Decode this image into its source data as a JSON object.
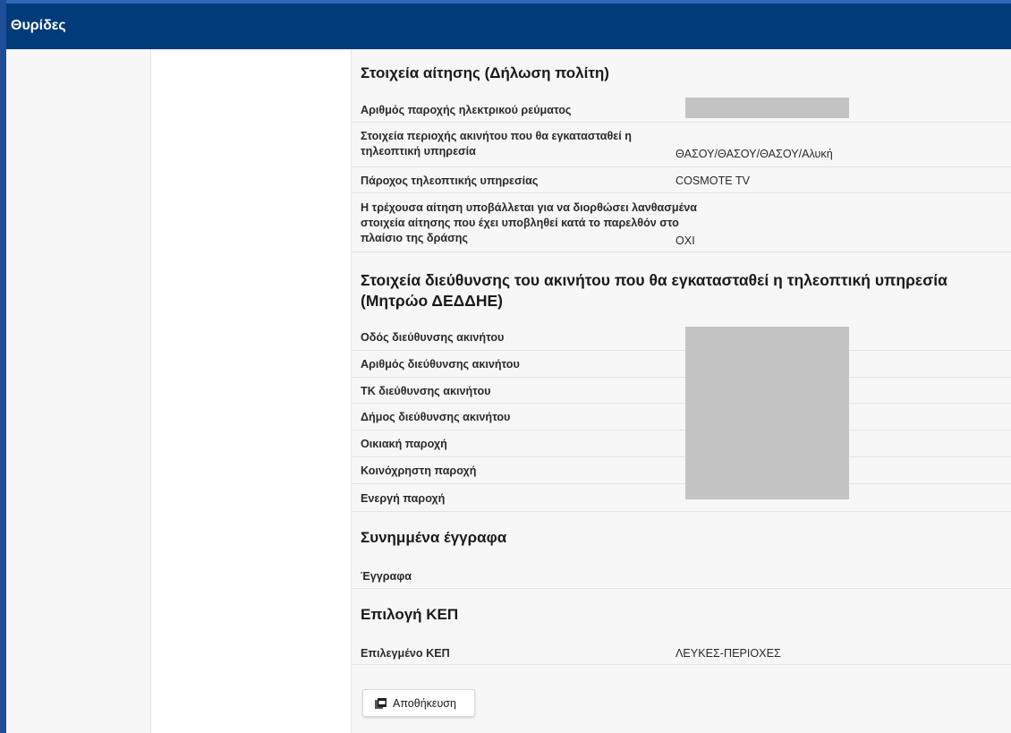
{
  "header": {
    "title": "Θυρίδες"
  },
  "sections": {
    "application": {
      "title": "Στοιχεία αίτησης (Δήλωση πολίτη)",
      "rows": [
        {
          "label": "Αριθμός παροχής ηλεκτρικού ρεύματος",
          "value": ""
        },
        {
          "label": "Στοιχεία περιοχής ακινήτου που θα εγκατασταθεί η τηλεοπτική υπηρεσία",
          "value": "ΘΑΣΟΥ/ΘΑΣΟΥ/ΘΑΣΟΥ/Αλυκή"
        },
        {
          "label": "Πάροχος τηλεοπτικής υπηρεσίας",
          "value": "COSMOTE TV"
        },
        {
          "label": "Η τρέχουσα αίτηση υποβάλλεται για να διορθώσει λανθασμένα στοιχεία αίτησης που έχει υποβληθεί κατά το παρελθόν στο πλαίσιο της δράσης",
          "value": "ΟΧΙ"
        }
      ]
    },
    "address": {
      "title": "Στοιχεία διεύθυνσης του ακινήτου που θα εγκατασταθεί η τηλεοπτική υπηρεσία (Μητρώο ΔΕΔΔΗΕ)",
      "rows": [
        {
          "label": "Οδός διεύθυνσης ακινήτου",
          "value": ""
        },
        {
          "label": "Αριθμός διεύθυνσης ακινήτου",
          "value": ""
        },
        {
          "label": "ΤΚ διεύθυνσης ακινήτου",
          "value": ""
        },
        {
          "label": "Δήμος διεύθυνσης ακινήτου",
          "value": ""
        },
        {
          "label": "Οικιακή παροχή",
          "value": ""
        },
        {
          "label": "Κοινόχρηστη παροχή",
          "value": ""
        },
        {
          "label": "Ενεργή παροχή",
          "value": ""
        }
      ]
    },
    "attachments": {
      "title": "Συνημμένα έγγραφα",
      "rows": [
        {
          "label": "Έγγραφα",
          "value": ""
        }
      ]
    },
    "kep": {
      "title": "Επιλογή ΚΕΠ",
      "rows": [
        {
          "label": "Επιλεγμένο ΚΕΠ",
          "value": "ΛΕΥΚΕΣ-ΠΕΡΙΟΧΕΣ"
        }
      ]
    }
  },
  "actions": {
    "save_label": "Αποθήκευση",
    "save_icon": "pdf-file-icon"
  }
}
